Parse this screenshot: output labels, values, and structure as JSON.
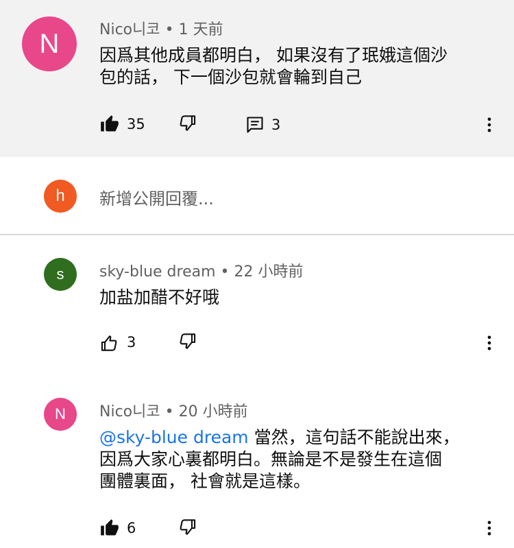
{
  "colors": {
    "highlight_bg": "#f2f2f2",
    "avatar_n": "#e8478a",
    "avatar_h": "#f15a22",
    "avatar_s": "#2f6e1f",
    "mention": "#1a73e8",
    "meta": "#606060"
  },
  "comments": [
    {
      "avatar_letter": "N",
      "author": "Nico니코",
      "time": "1 天前",
      "text_line1": "因爲其他成員都明白， 如果沒有了珉娥這個沙",
      "text_line2": "包的話， 下一個沙包就會輪到自己",
      "likes": "35",
      "replies": "3",
      "like_icon": "thumbs-up-filled-icon"
    },
    {
      "avatar_letter": "s",
      "author": "sky-blue dream",
      "time": "22 小時前",
      "text": "加盐加醋不好哦",
      "likes": "3",
      "like_icon": "thumbs-up-outline-icon"
    },
    {
      "avatar_letter": "N",
      "author": "Nico니코",
      "time": "20 小時前",
      "mention": "@sky-blue dream",
      "text_line1": " 當然，這句話不能說出來，",
      "text_line2": "因爲大家心裏都明白。無論是不是發生在這個",
      "text_line3": "團體裏面， 社會就是這樣。",
      "likes": "6",
      "like_icon": "thumbs-up-filled-icon"
    }
  ],
  "reply_box": {
    "avatar_letter": "h",
    "placeholder": "新增公開回覆..."
  },
  "separator": " • "
}
